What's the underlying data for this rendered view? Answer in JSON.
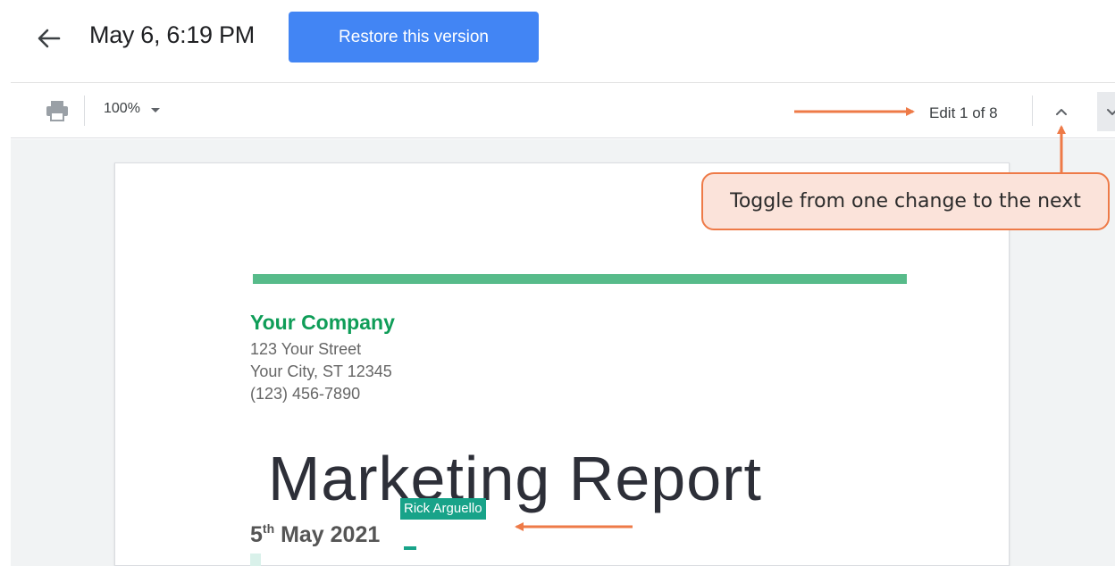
{
  "header": {
    "version_title": "May 6, 6:19 PM",
    "restore_label": "Restore this version"
  },
  "toolbar": {
    "zoom": "100%",
    "edit_counter": "Edit 1 of 8"
  },
  "document": {
    "company_name": "Your Company",
    "address_line1": "123 Your Street",
    "address_line2": "Your City, ST 12345",
    "phone": "(123) 456-7890",
    "title": "Marketing Report",
    "date_day": "5",
    "date_suffix": "th",
    "date_rest": " May 2021",
    "edit_author": "Rick Arguello"
  },
  "annotation": {
    "callout_text": "Toggle from one change to the next"
  },
  "colors": {
    "accent_blue": "#4285f4",
    "brand_green": "#0f9d58",
    "divider_green": "#57bb8a",
    "edit_teal": "#18a389",
    "annotation_orange": "#ee7a47"
  },
  "icons": {
    "back": "arrow-left-icon",
    "print": "printer-icon",
    "zoom_caret": "caret-down-icon",
    "prev_edit": "chevron-up-icon",
    "next_edit": "chevron-down-icon"
  }
}
